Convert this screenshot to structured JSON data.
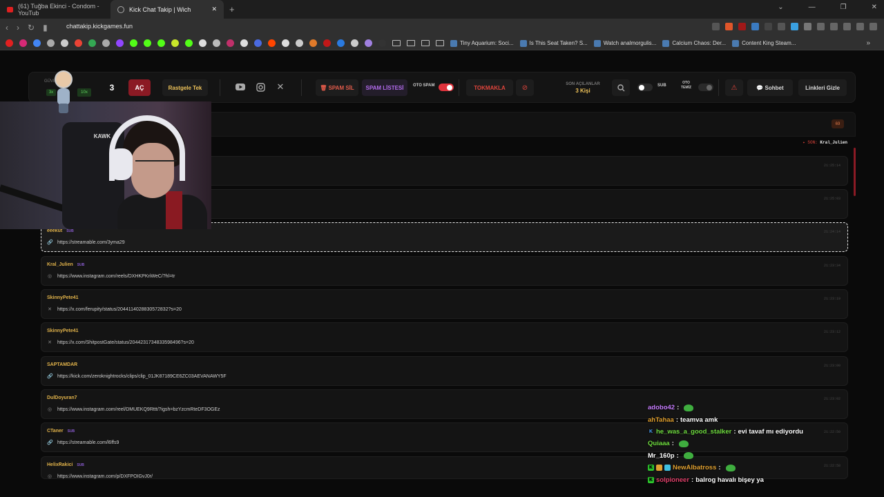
{
  "browser": {
    "tabs": [
      {
        "title": "(61) Tuğba Ekinci - Condom - YouTub",
        "active": false
      },
      {
        "title": "Kick Chat Takip | Wich",
        "active": true
      }
    ],
    "url": "chattakip.kickgames.fun",
    "bookmarks": [
      "Tiny Aquarium: Soci...",
      "Is This Seat Taken? S...",
      "Watch analmorgulis...",
      "Calcium Chaos: Der...",
      "Content King Steam..."
    ]
  },
  "toolbar": {
    "guven_label": "GÜVE",
    "mult_3x": "3x",
    "mult_10x": "10x",
    "count": "3",
    "ac_label": "AÇ",
    "rastgele_label": "Rastgele Tek",
    "spam_sil_label": "SPAM SİL",
    "spam_listesi_label": "SPAM LİSTESİ",
    "oto_spam_label": "OTO SPAM",
    "oto_spam_on": true,
    "tokmakla_label": "TOKMAKLA",
    "son_acilanlar_label": "SON AÇILANLAR",
    "son_acilanlar_value": "3 Kişi",
    "sub_label": "SUB",
    "oto_temiz_l1": "OTO",
    "oto_temiz_l2": "TEMİZ",
    "sohbet_label": "Sohbet",
    "linkleri_gizle_label": "Linkleri Gizle"
  },
  "list": {
    "count_badge": "69",
    "son_label": "SON:",
    "son_user": "Kral_Julien",
    "items": [
      {
        "user": "",
        "sub": false,
        "link": "",
        "icon": "link",
        "time": "21:25:14"
      },
      {
        "user": "",
        "sub": false,
        "link": "",
        "icon": "link",
        "time": "21:25:03"
      },
      {
        "user": "eeekut",
        "sub": true,
        "link": "https://streamable.com/3yma29",
        "icon": "link",
        "time": "21:24:14"
      },
      {
        "user": "Kral_Julien",
        "sub": true,
        "link": "https://www.instagram.com/reels/DXHKPKriWeC/?hl=tr",
        "icon": "instagram",
        "time": "21:23:34"
      },
      {
        "user": "SkinnyPete41",
        "sub": false,
        "link": "https://x.com/ferupity/status/2044114028830572832?s=20",
        "icon": "x",
        "time": "21:23:19"
      },
      {
        "user": "SkinnyPete41",
        "sub": false,
        "link": "https://x.com/ShitpostGate/status/2044231734833598496?s=20",
        "icon": "x",
        "time": "21:23:12"
      },
      {
        "user": "SAPTAMDAR",
        "sub": false,
        "link": "https://kick.com/zeroknightrocks/clips/clip_01JK87189CE6ZC03AEVANAWY5F",
        "icon": "link",
        "time": "21:23:00"
      },
      {
        "user": "DulDoyuran7",
        "sub": false,
        "link": "https://www.instagram.com/reel/DMUEKQ9Rttt/?igsh=bzYzcmRteDF3OGEz",
        "icon": "instagram",
        "time": "21:23:02"
      },
      {
        "user": "CTaner",
        "sub": true,
        "link": "https://streamable.com/l6ffs9",
        "icon": "link",
        "time": "21:22:50"
      },
      {
        "user": "HelixRakici",
        "sub": true,
        "link": "https://www.instagram.com/p/DXFPOIGvJ0r/",
        "icon": "instagram",
        "time": "21:22:58"
      }
    ],
    "sub_tag": "SUB"
  },
  "webcam": {
    "chair_logo": "KAWK"
  },
  "chat": [
    {
      "user": "adobo42",
      "color": "#c77dff",
      "msg": "",
      "emote": true,
      "badges": []
    },
    {
      "user": "ahTahaa",
      "color": "#e0a030",
      "msg": "teamva amk",
      "emote": false,
      "badges": []
    },
    {
      "user": "he_was_a_good_stalker",
      "color": "#6fdc3f",
      "msg": "evi tavaf mı ediyordu",
      "emote": false,
      "badges": [
        "k-blue"
      ]
    },
    {
      "user": "Quiaaa",
      "color": "#6fdc3f",
      "msg": "",
      "emote": true,
      "badges": []
    },
    {
      "user": "Mr_160p",
      "color": "#ffffff",
      "msg": "",
      "emote": true,
      "badges": []
    },
    {
      "user": "NewAlbatross",
      "color": "#e0a030",
      "msg": "",
      "emote": true,
      "badges": [
        "k",
        "o",
        "g"
      ]
    },
    {
      "user": "solpioneer",
      "color": "#e0406a",
      "msg": "balrog havalı bişey ya",
      "emote": false,
      "badges": [
        "k"
      ]
    }
  ]
}
